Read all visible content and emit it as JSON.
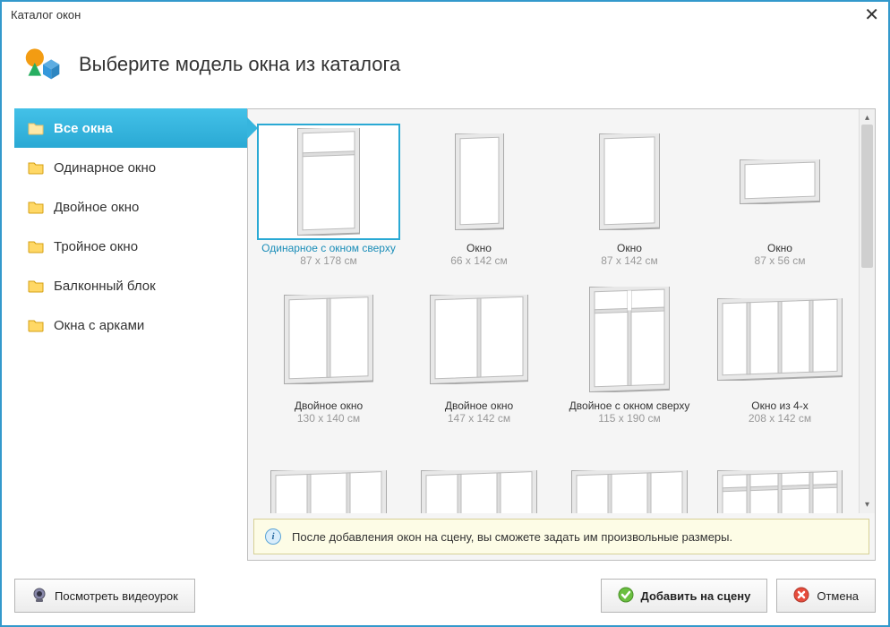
{
  "window": {
    "title": "Каталог окон"
  },
  "header": {
    "title": "Выберите модель окна из каталога"
  },
  "sidebar": {
    "items": [
      {
        "label": "Все окна",
        "active": true
      },
      {
        "label": "Одинарное окно",
        "active": false
      },
      {
        "label": "Двойное окно",
        "active": false
      },
      {
        "label": "Тройное окно",
        "active": false
      },
      {
        "label": "Балконный блок",
        "active": false
      },
      {
        "label": "Окна с арками",
        "active": false
      }
    ]
  },
  "catalog": {
    "items": [
      {
        "name": "Одинарное с окном сверху",
        "size": "87 x 178 см",
        "type": "single-top",
        "selected": true
      },
      {
        "name": "Окно",
        "size": "66 x 142 см",
        "type": "single-narrow"
      },
      {
        "name": "Окно",
        "size": "87 x 142 см",
        "type": "single"
      },
      {
        "name": "Окно",
        "size": "87 x 56 см",
        "type": "wide-short"
      },
      {
        "name": "Двойное окно",
        "size": "130 x 140 см",
        "type": "double"
      },
      {
        "name": "Двойное окно",
        "size": "147 x 142 см",
        "type": "double-wide"
      },
      {
        "name": "Двойное с окном сверху",
        "size": "115 x 190 см",
        "type": "double-top"
      },
      {
        "name": "Окно из 4-х",
        "size": "208 x 142 см",
        "type": "quad"
      },
      {
        "name": "",
        "size": "",
        "type": "triple"
      },
      {
        "name": "",
        "size": "",
        "type": "triple"
      },
      {
        "name": "",
        "size": "",
        "type": "triple"
      },
      {
        "name": "",
        "size": "",
        "type": "quad-top"
      }
    ]
  },
  "hint": {
    "text": "После добавления окон на сцену, вы сможете задать им произвольные размеры."
  },
  "footer": {
    "video_label": "Посмотреть видеоурок",
    "add_label": "Добавить на сцену",
    "cancel_label": "Отмена"
  }
}
